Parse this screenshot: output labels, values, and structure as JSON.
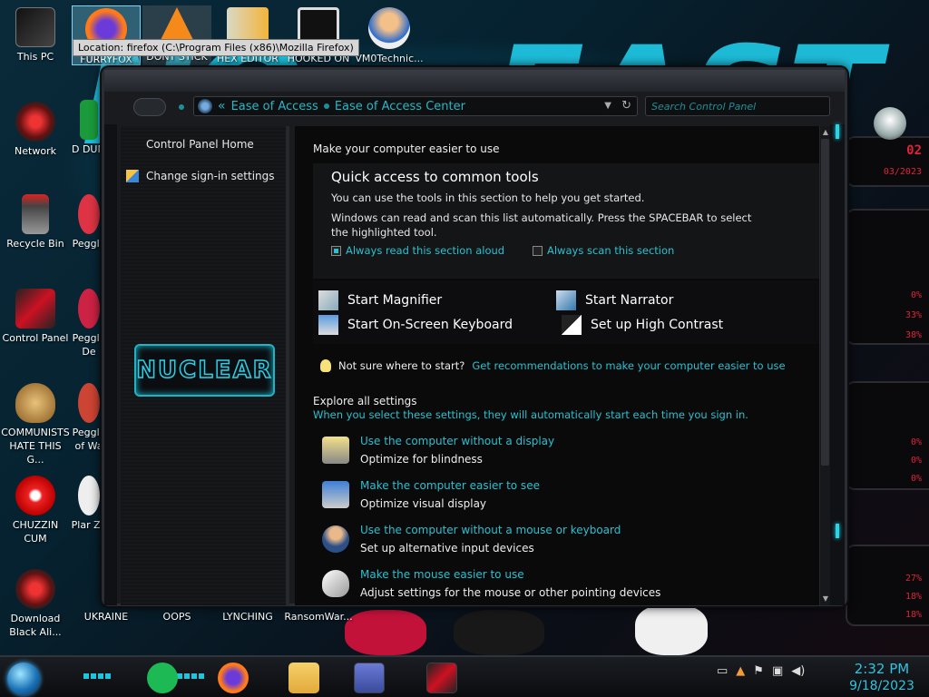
{
  "tooltip": "Location: firefox (C:\\Program Files (x86)\\Mozilla Firefox)",
  "desktop": {
    "left_icons": [
      {
        "label": "This PC",
        "name": "desktop-icon-this-pc"
      },
      {
        "label": "Network",
        "name": "desktop-icon-network"
      },
      {
        "label": "Recycle Bin",
        "name": "desktop-icon-recycle-bin"
      },
      {
        "label": "Control Panel",
        "name": "desktop-icon-control-panel"
      },
      {
        "label": "COMMUNISTS HATE THIS G...",
        "name": "desktop-icon-communists"
      },
      {
        "label": "CHUZZIN CUM",
        "name": "desktop-icon-chuzzin"
      },
      {
        "label": "Download Black Ali...",
        "name": "desktop-icon-download-black-ali"
      }
    ],
    "col2_icons": [
      {
        "label": "D DUM",
        "name": "desktop-icon-d-dum"
      },
      {
        "label": "Peggle",
        "name": "desktop-icon-peggle"
      },
      {
        "label": "Peggle De",
        "name": "desktop-icon-peggle-de"
      },
      {
        "label": "Peggle of Wa",
        "name": "desktop-icon-peggle-of-wa"
      },
      {
        "label": "Plar Zo",
        "name": "desktop-icon-plar-zo"
      },
      {
        "label": "UKRAINE",
        "name": "desktop-icon-ukraine"
      }
    ],
    "top_icons": [
      {
        "label": "FURRYFOX",
        "name": "desktop-icon-furryfox"
      },
      {
        "label": "DONT STICK",
        "name": "desktop-icon-dont-stick"
      },
      {
        "label": "HEX EDITOR",
        "name": "desktop-icon-hex-editor"
      },
      {
        "label": "HOOKED ON",
        "name": "desktop-icon-hooked-on"
      },
      {
        "label": "VM0Technic...",
        "name": "desktop-icon-vm0technic"
      }
    ],
    "bottom_labels": [
      "OOPS",
      "LYNCHING",
      "RansomWar..."
    ]
  },
  "widget": {
    "readouts": [
      "02",
      "03/2023",
      "0%",
      "33%",
      "38%",
      "0%",
      "0%",
      "0%",
      "27%",
      "18%",
      "18%"
    ]
  },
  "window": {
    "breadcrumb": [
      "Ease of Access",
      "Ease of Access Center"
    ],
    "search_placeholder": "Search Control Panel",
    "left": {
      "home": "Control Panel Home",
      "signin": "Change sign-in settings",
      "logo_text": "NUCLEAR"
    },
    "main": {
      "title": "Make your computer easier to use",
      "quick": {
        "title": "Quick access to common tools",
        "line1": "You can use the tools in this section to help you get started.",
        "line2": "Windows can read and scan this list automatically.  Press the SPACEBAR to select the highlighted tool.",
        "cb_read": "Always read this section aloud",
        "cb_scan": "Always scan this section"
      },
      "tools": {
        "magnifier": "Start Magnifier",
        "narrator": "Start Narrator",
        "keyboard": "Start On-Screen Keyboard",
        "contrast": "Set up High Contrast"
      },
      "tip": {
        "question": "Not sure where to start?",
        "link": "Get recommendations to make your computer easier to use"
      },
      "explore": {
        "heading": "Explore all settings",
        "sub": "When you select these settings, they will automatically start each time you sign in.",
        "items": [
          {
            "link": "Use the computer without a display",
            "desc": "Optimize for blindness"
          },
          {
            "link": "Make the computer easier to see",
            "desc": "Optimize visual display"
          },
          {
            "link": "Use the computer without a mouse or keyboard",
            "desc": "Set up alternative input devices"
          },
          {
            "link": "Make the mouse easier to use",
            "desc": "Adjust settings for the mouse or other pointing devices"
          }
        ]
      }
    }
  },
  "taskbar": {
    "time": "2:32 PM",
    "date": "9/18/2023"
  },
  "colors": {
    "accent": "#2bc0cf",
    "window_bg": "#0a0a0b",
    "clock": "#2ec4dd"
  }
}
